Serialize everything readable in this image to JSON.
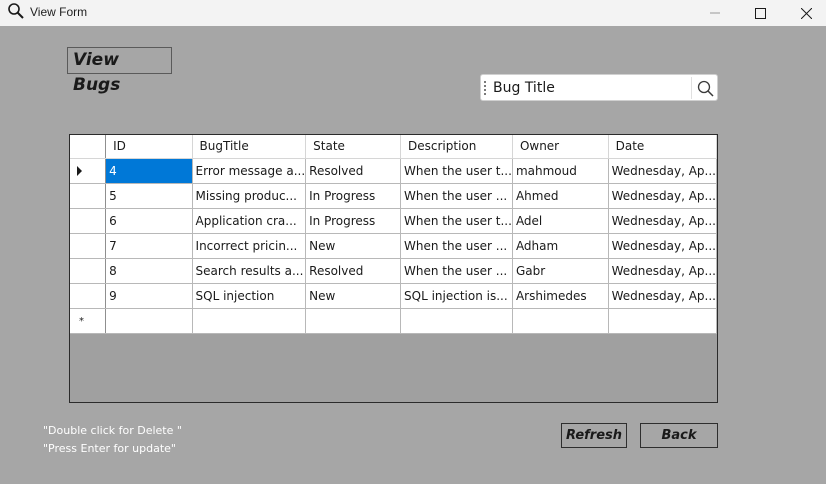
{
  "window": {
    "title": "View Form",
    "icon": "search-icon"
  },
  "header": {
    "title": "View Bugs"
  },
  "search": {
    "value": "Bug Title",
    "icon": "search-icon"
  },
  "grid": {
    "columns": [
      "ID",
      "BugTitle",
      "State",
      "Description",
      "Owner",
      "Date"
    ],
    "rows": [
      [
        "4",
        "Error message a...",
        "Resolved",
        "When the user t...",
        "mahmoud",
        "Wednesday, Ap..."
      ],
      [
        "5",
        "Missing produc...",
        "In Progress",
        "When the user ...",
        "Ahmed",
        "Wednesday, Ap..."
      ],
      [
        "6",
        "Application cra...",
        "In Progress",
        "When the user t...",
        "Adel",
        "Wednesday, Ap..."
      ],
      [
        "7",
        "Incorrect pricin...",
        "New",
        "When the user ...",
        "Adham",
        "Wednesday, Ap..."
      ],
      [
        "8",
        "Search results a...",
        "Resolved",
        " When the user ...",
        "Gabr",
        "Wednesday, Ap..."
      ],
      [
        "9",
        "SQL injection",
        "New",
        "SQL injection is...",
        "Arshimedes",
        "Wednesday, Ap..."
      ]
    ],
    "selected_row_marker": "arrow",
    "new_row_marker": "*",
    "selection_color": "#0078d7"
  },
  "hints": {
    "delete": "\"Double click for Delete \"",
    "update": "\"Press Enter for update\""
  },
  "buttons": {
    "refresh": "Refresh",
    "back": "Back"
  }
}
